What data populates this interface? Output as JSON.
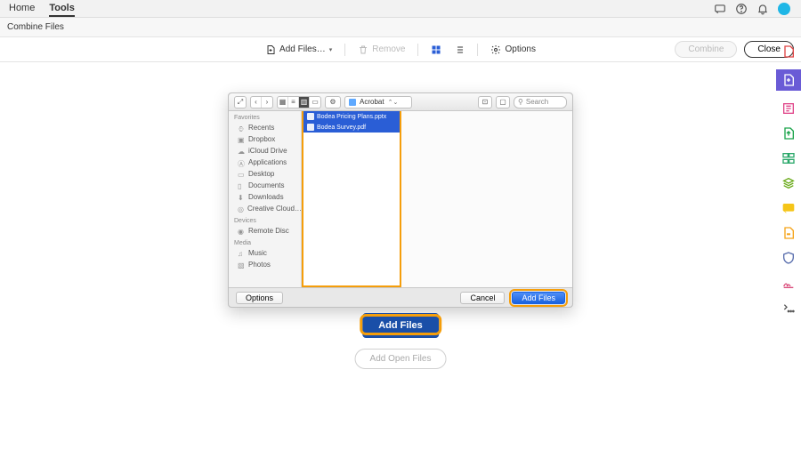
{
  "header": {
    "tabs": [
      {
        "label": "Home",
        "active": false
      },
      {
        "label": "Tools",
        "active": true
      }
    ],
    "icons": [
      "chat",
      "help",
      "bell",
      "avatar"
    ]
  },
  "subheader": {
    "title": "Combine Files"
  },
  "toolbar": {
    "add_files_label": "Add Files…",
    "remove_label": "Remove",
    "options_label": "Options",
    "combine_label": "Combine",
    "close_label": "Close"
  },
  "finder": {
    "location_label": "Acrobat",
    "search_placeholder": "Search",
    "sidebar": {
      "favorites_heading": "Favorites",
      "favorites": [
        "Recents",
        "Dropbox",
        "iCloud Drive",
        "Applications",
        "Desktop",
        "Documents",
        "Downloads",
        "Creative Cloud…"
      ],
      "devices_heading": "Devices",
      "devices": [
        "Remote Disc"
      ],
      "media_heading": "Media",
      "media": [
        "Music",
        "Photos"
      ]
    },
    "files": [
      {
        "name": "Bodea Pricing Plans.pptx"
      },
      {
        "name": "Bodea Survey.pdf"
      }
    ],
    "footer": {
      "options_label": "Options",
      "cancel_label": "Cancel",
      "add_files_label": "Add Files"
    }
  },
  "main_buttons": {
    "add_files_label": "Add Files",
    "add_open_files_label": "Add Open Files"
  },
  "rail_icons": [
    "page-icon",
    "create-icon",
    "edit-icon",
    "export-icon",
    "organize-icon",
    "compress-icon",
    "comment-icon",
    "highlight-icon",
    "protect-icon",
    "sign-icon",
    "more-icon"
  ]
}
